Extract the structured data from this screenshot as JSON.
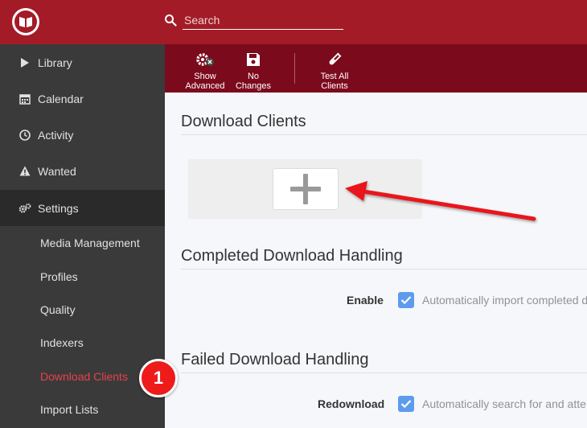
{
  "header": {
    "search_placeholder": "Search"
  },
  "sidebar": {
    "items": [
      {
        "label": "Library",
        "icon": "play-icon"
      },
      {
        "label": "Calendar",
        "icon": "calendar-icon"
      },
      {
        "label": "Activity",
        "icon": "clock-icon"
      },
      {
        "label": "Wanted",
        "icon": "warning-icon"
      },
      {
        "label": "Settings",
        "icon": "gears-icon"
      }
    ],
    "settings_sub": [
      {
        "label": "Media Management"
      },
      {
        "label": "Profiles"
      },
      {
        "label": "Quality"
      },
      {
        "label": "Indexers"
      },
      {
        "label": "Download Clients"
      },
      {
        "label": "Import Lists"
      }
    ]
  },
  "toolbar": {
    "show_advanced": [
      "Show",
      "Advanced"
    ],
    "no_changes": [
      "No",
      "Changes"
    ],
    "test_all": [
      "Test All",
      "Clients"
    ]
  },
  "main": {
    "download_clients_title": "Download Clients",
    "completed_title": "Completed Download Handling",
    "failed_title": "Failed Download Handling",
    "enable_label": "Enable",
    "enable_help": "Automatically import completed d",
    "redownload_label": "Redownload",
    "redownload_help": "Automatically search for and atte"
  },
  "annotation": {
    "step_number": "1"
  },
  "colors": {
    "header": "#a31b27",
    "toolbar": "#7c0a1d",
    "sidebar": "#3a3a3a",
    "accent_link": "#e8414c",
    "checkbox": "#5d9cec",
    "badge": "#ee1b1b"
  }
}
